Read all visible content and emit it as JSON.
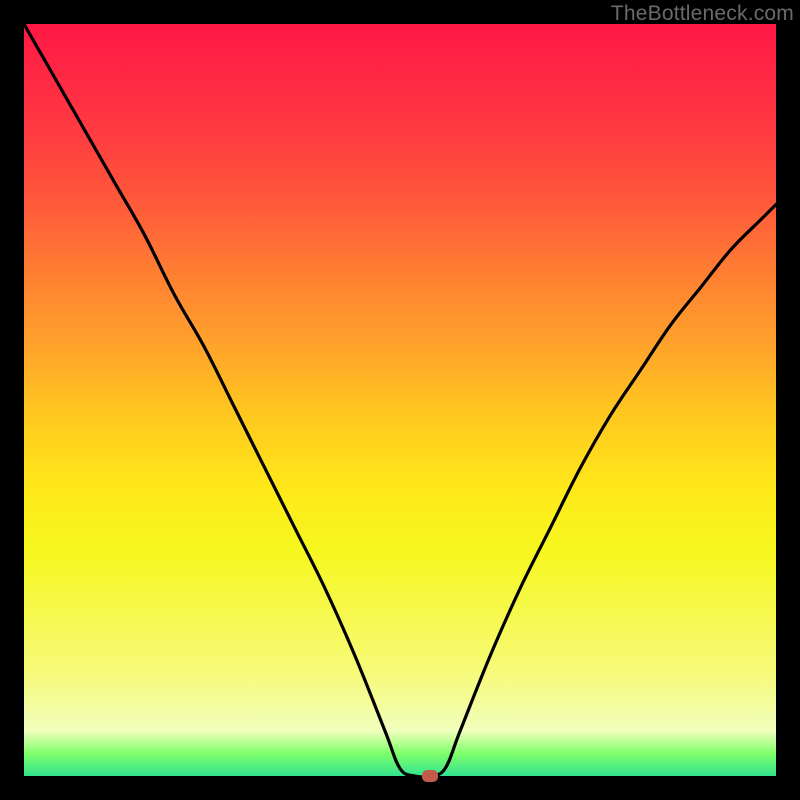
{
  "watermark": "TheBottleneck.com",
  "chart_data": {
    "type": "line",
    "title": "",
    "xlabel": "",
    "ylabel": "",
    "xlim": [
      0,
      100
    ],
    "ylim": [
      0,
      100
    ],
    "x": [
      0,
      4,
      8,
      12,
      16,
      20,
      24,
      28,
      32,
      36,
      40,
      44,
      48,
      50,
      52,
      54,
      56,
      58,
      62,
      66,
      70,
      74,
      78,
      82,
      86,
      90,
      94,
      98,
      100
    ],
    "y": [
      100,
      93,
      86,
      79,
      72,
      64,
      57,
      49,
      41,
      33,
      25,
      16,
      6,
      1,
      0,
      0,
      1,
      6,
      16,
      25,
      33,
      41,
      48,
      54,
      60,
      65,
      70,
      74,
      76
    ],
    "marker": {
      "x": 54,
      "y": 0
    },
    "colors": {
      "curve": "#000000",
      "marker": "#c45a4a",
      "gradient_top": "#ff1744",
      "gradient_bottom": "#33e38f"
    }
  }
}
